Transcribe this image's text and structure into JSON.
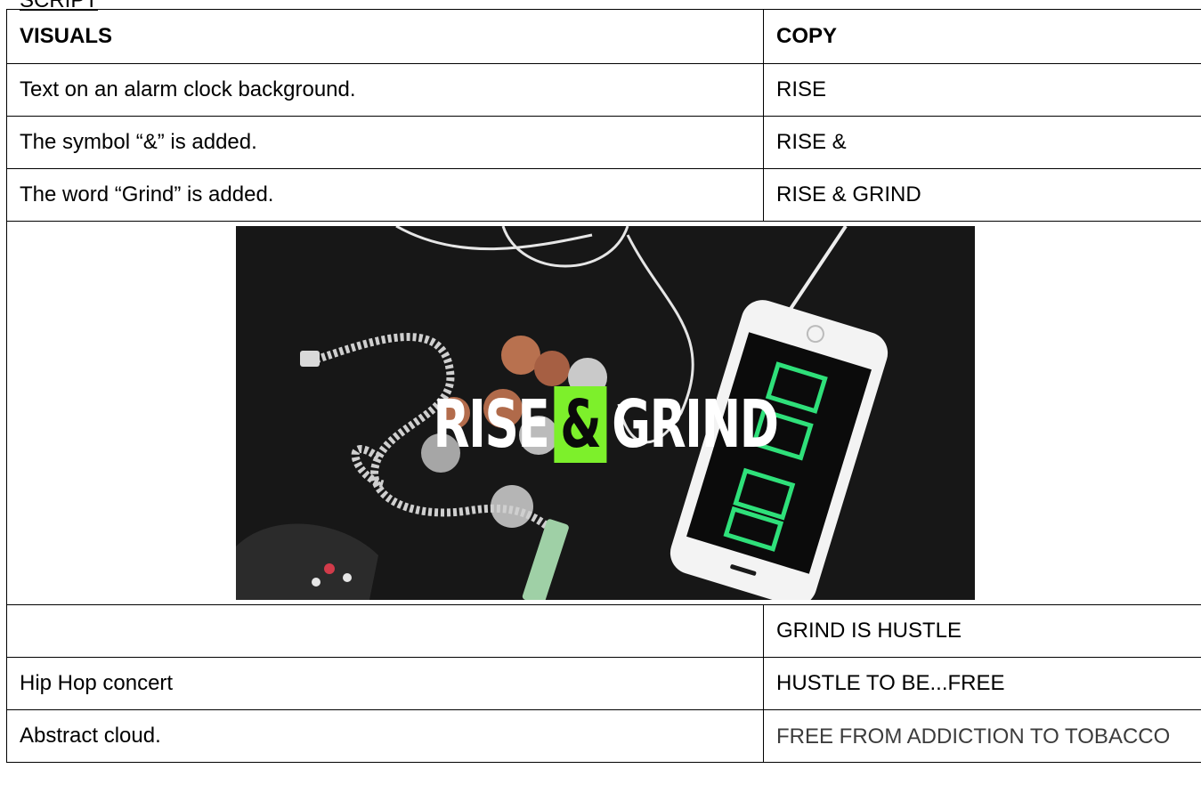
{
  "document": {
    "heading": "SCRIPT"
  },
  "table": {
    "headers": {
      "visuals": "VISUALS",
      "copy": "COPY"
    },
    "rows_before_image": [
      {
        "visual": "Text on an alarm clock background.",
        "copy": "RISE"
      },
      {
        "visual": "The symbol “&” is added.",
        "copy": "RISE &"
      },
      {
        "visual": "The word “Grind” is added.",
        "copy": "RISE & GRIND"
      }
    ],
    "rows_after_image": [
      {
        "visual": "",
        "copy": "GRIND IS HUSTLE"
      },
      {
        "visual": "Hip Hop concert",
        "copy": "HUSTLE TO BE...FREE"
      },
      {
        "visual": "Abstract cloud.",
        "copy": "FREE FROM ADDICTION TO TOBACCO"
      }
    ]
  },
  "image": {
    "title_part1": "RISE",
    "title_amp": "&",
    "title_part2": "GRIND",
    "accent_color": "#7df02b",
    "phone_clock_color": "#2fe07a"
  }
}
